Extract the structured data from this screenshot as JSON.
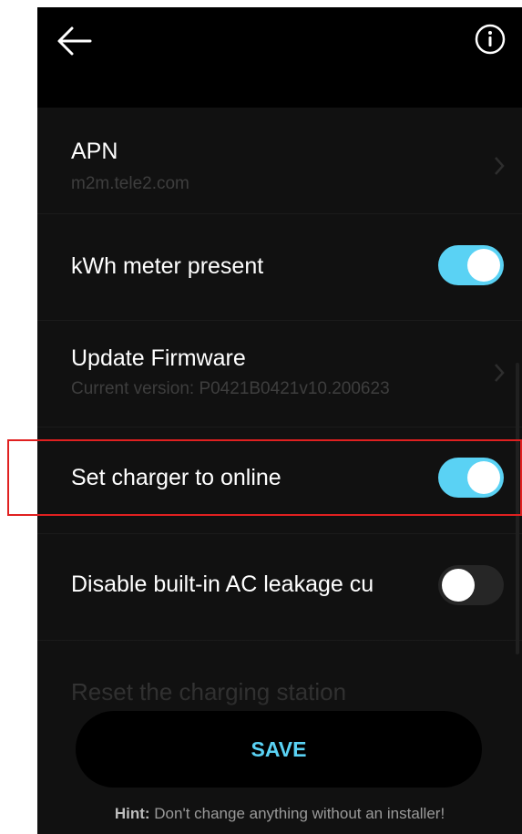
{
  "header": {
    "back_icon": "arrow-left-icon",
    "info_icon": "info-circle-icon"
  },
  "settings": [
    {
      "title": "APN",
      "subtitle": "m2m.tele2.com",
      "type": "link"
    },
    {
      "title": "kWh meter present",
      "type": "toggle",
      "enabled": true
    },
    {
      "title": "Update Firmware",
      "subtitle": "Current version:  P0421B0421v10.200623",
      "type": "link"
    },
    {
      "title": "Set charger to online",
      "type": "toggle",
      "enabled": true
    },
    {
      "title": "Disable built-in AC leakage cu",
      "type": "toggle",
      "enabled": false
    },
    {
      "title": "Reset the charging station",
      "type": "link"
    }
  ],
  "footer": {
    "save_label": "SAVE",
    "hint_prefix": "Hint:",
    "hint_text": " Don't change anything without an installer!"
  },
  "colors": {
    "accent": "#5ad2f4",
    "background": "#111111",
    "highlight": "#e02020"
  }
}
